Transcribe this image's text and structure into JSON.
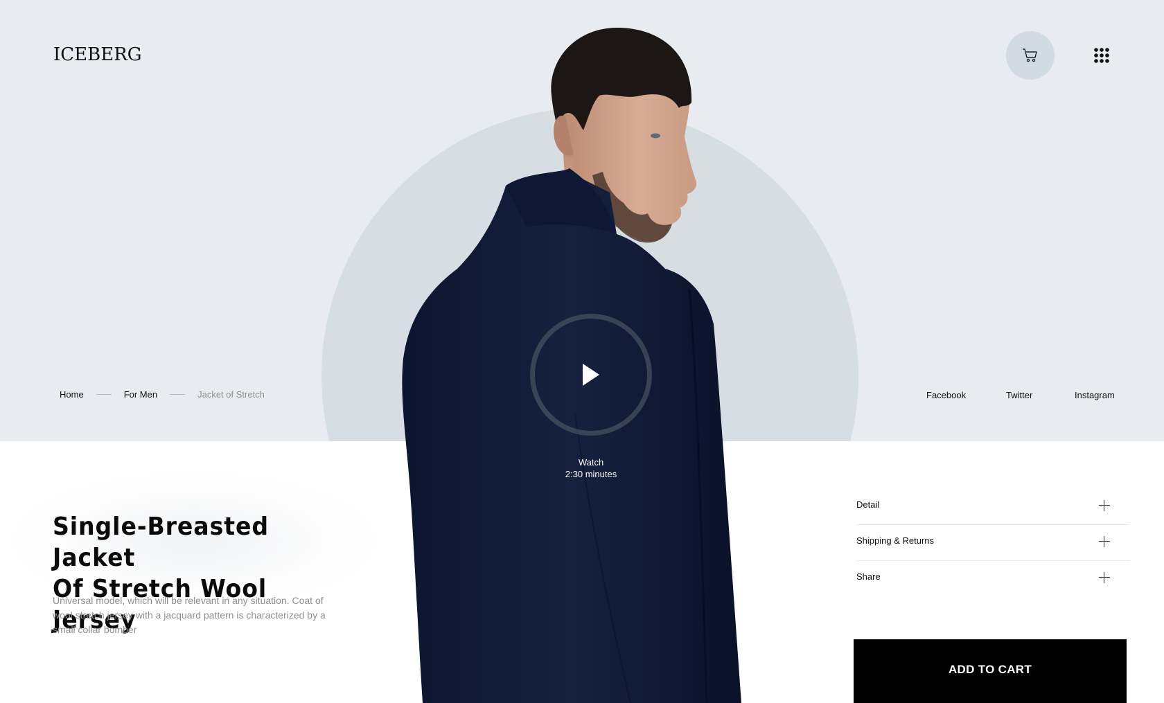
{
  "header": {
    "logo": "ICEBERG",
    "cart_icon": "cart-icon",
    "menu_icon": "grid-menu-icon"
  },
  "breadcrumb": {
    "items": [
      "Home",
      "For Men",
      "Jacket of Stretch"
    ]
  },
  "social": {
    "links": [
      "Facebook",
      "Twitter",
      "Instagram"
    ]
  },
  "video": {
    "icon": "play-icon",
    "label": "Watch",
    "duration": "2:30 minutes"
  },
  "product": {
    "title_line1": "Single-Breasted Jacket",
    "title_line2": "Of Stretch Wool Jersey",
    "description": "Universal model, which will be relevant in any situation. Coat of wool stretch jersey with a jacquard pattern is characterized by a small collar bomber"
  },
  "accordion": {
    "items": [
      {
        "label": "Detail",
        "icon": "plus-icon"
      },
      {
        "label": "Shipping & Returns",
        "icon": "plus-icon"
      },
      {
        "label": "Share",
        "icon": "plus-icon"
      }
    ]
  },
  "cta": {
    "add_to_cart": "ADD TO CART"
  },
  "colors": {
    "top_background": "#e8ecf0",
    "circle": "#d6dee3",
    "jacket": "#101a33",
    "button": "#000000"
  }
}
